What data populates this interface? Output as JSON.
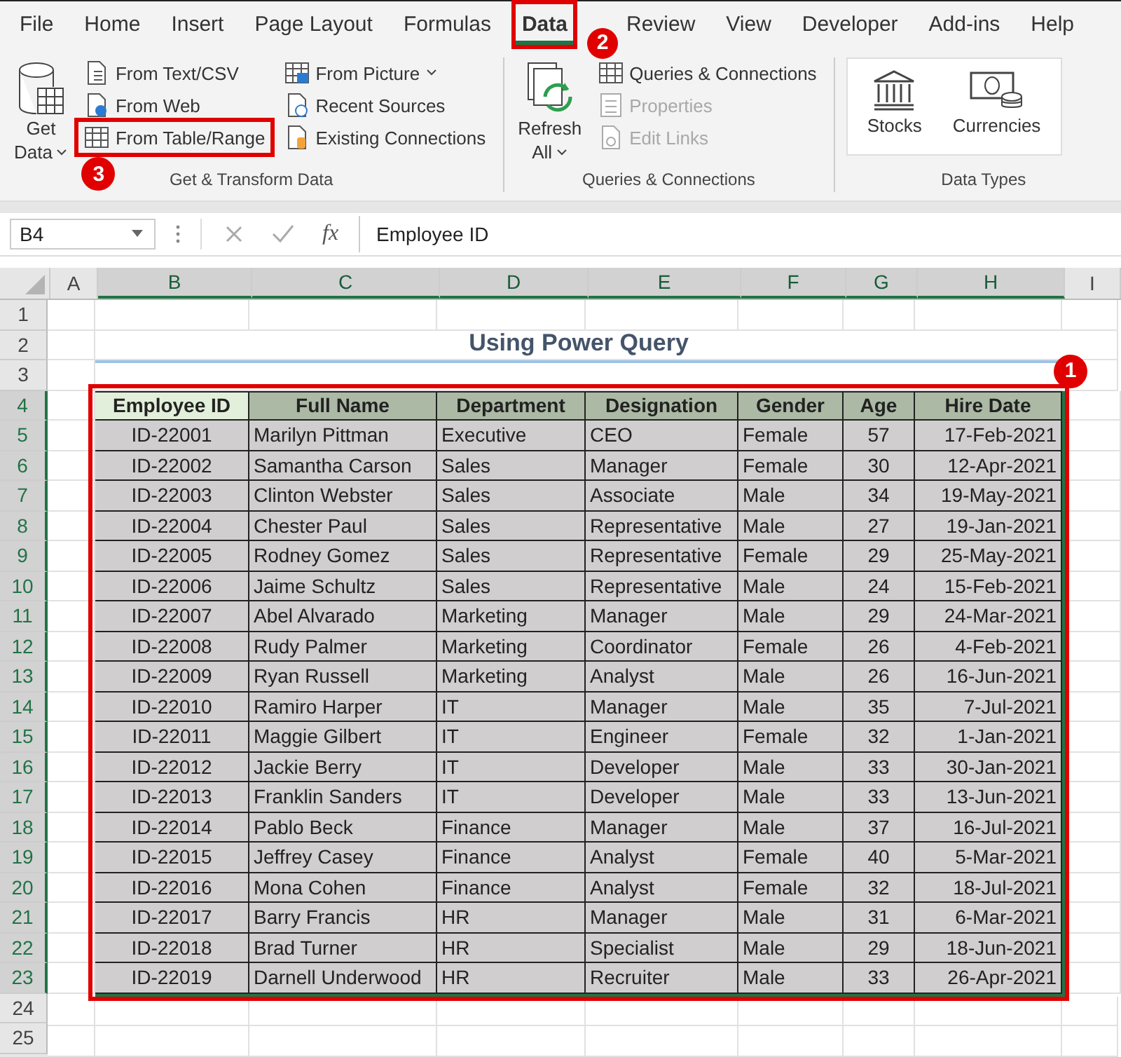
{
  "ribbon_tabs": [
    {
      "label": "File",
      "selected": false
    },
    {
      "label": "Home",
      "selected": false
    },
    {
      "label": "Insert",
      "selected": false
    },
    {
      "label": "Page Layout",
      "selected": false
    },
    {
      "label": "Formulas",
      "selected": false
    },
    {
      "label": "Data",
      "selected": true,
      "callout": "2"
    },
    {
      "label": "Review",
      "selected": false
    },
    {
      "label": "View",
      "selected": false
    },
    {
      "label": "Developer",
      "selected": false
    },
    {
      "label": "Add-ins",
      "selected": false
    },
    {
      "label": "Help",
      "selected": false
    }
  ],
  "ribbon_groups": [
    {
      "label": "Get & Transform Data",
      "big": {
        "kind": "database",
        "lines": [
          "Get",
          "Data"
        ],
        "dropdown": true
      },
      "columns": [
        [
          {
            "kind": "text-file",
            "label": "From Text/CSV",
            "disabled": false
          },
          {
            "kind": "web",
            "label": "From Web",
            "disabled": false
          },
          {
            "kind": "table",
            "label": "From Table/Range",
            "disabled": false,
            "callout": "3"
          }
        ],
        [
          {
            "kind": "picture",
            "label": "From Picture",
            "disabled": false,
            "dropdown": true
          },
          {
            "kind": "recent",
            "label": "Recent Sources",
            "disabled": false
          },
          {
            "kind": "connection",
            "label": "Existing Connections",
            "disabled": false
          }
        ]
      ]
    },
    {
      "label": "Queries & Connections",
      "big": {
        "kind": "refresh",
        "lines": [
          "Refresh",
          "All"
        ],
        "dropdown": true
      },
      "columns": [
        [
          {
            "kind": "queries",
            "label": "Queries & Connections",
            "disabled": false
          },
          {
            "kind": "properties",
            "label": "Properties",
            "disabled": true
          },
          {
            "kind": "links",
            "label": "Edit Links",
            "disabled": true
          }
        ]
      ]
    },
    {
      "label": "Data Types",
      "gallery": [
        {
          "kind": "bank",
          "label": "Stocks"
        },
        {
          "kind": "currency",
          "label": "Currencies"
        }
      ]
    }
  ],
  "formula_bar": {
    "name_box": "B4",
    "fx": "fx",
    "formula": "Employee ID"
  },
  "column_headers": [
    {
      "label": "A",
      "selected": false
    },
    {
      "label": "B",
      "selected": true
    },
    {
      "label": "C",
      "selected": true
    },
    {
      "label": "D",
      "selected": true
    },
    {
      "label": "E",
      "selected": true
    },
    {
      "label": "F",
      "selected": true
    },
    {
      "label": "G",
      "selected": true
    },
    {
      "label": "H",
      "selected": true
    },
    {
      "label": "I",
      "selected": false
    }
  ],
  "row_headers": [
    {
      "label": "1",
      "selected": false
    },
    {
      "label": "2",
      "selected": false
    },
    {
      "label": "3",
      "selected": false
    },
    {
      "label": "4",
      "selected": true
    },
    {
      "label": "5",
      "selected": true
    },
    {
      "label": "6",
      "selected": true
    },
    {
      "label": "7",
      "selected": true
    },
    {
      "label": "8",
      "selected": true
    },
    {
      "label": "9",
      "selected": true
    },
    {
      "label": "10",
      "selected": true
    },
    {
      "label": "11",
      "selected": true
    },
    {
      "label": "12",
      "selected": true
    },
    {
      "label": "13",
      "selected": true
    },
    {
      "label": "14",
      "selected": true
    },
    {
      "label": "15",
      "selected": true
    },
    {
      "label": "16",
      "selected": true
    },
    {
      "label": "17",
      "selected": true
    },
    {
      "label": "18",
      "selected": true
    },
    {
      "label": "19",
      "selected": true
    },
    {
      "label": "20",
      "selected": true
    },
    {
      "label": "21",
      "selected": true
    },
    {
      "label": "22",
      "selected": true
    },
    {
      "label": "23",
      "selected": true
    },
    {
      "label": "24",
      "selected": false
    },
    {
      "label": "25",
      "selected": false
    }
  ],
  "sheet_title": "Using Power Query",
  "table": {
    "callout": "1",
    "columns": [
      "Employee ID",
      "Full Name",
      "Department",
      "Designation",
      "Gender",
      "Age",
      "Hire Date"
    ],
    "rows": [
      [
        "ID-22001",
        "Marilyn Pittman",
        "Executive",
        "CEO",
        "Female",
        "57",
        "17-Feb-2021"
      ],
      [
        "ID-22002",
        "Samantha Carson",
        "Sales",
        "Manager",
        "Female",
        "30",
        "12-Apr-2021"
      ],
      [
        "ID-22003",
        "Clinton Webster",
        "Sales",
        "Associate",
        "Male",
        "34",
        "19-May-2021"
      ],
      [
        "ID-22004",
        "Chester Paul",
        "Sales",
        "Representative",
        "Male",
        "27",
        "19-Jan-2021"
      ],
      [
        "ID-22005",
        "Rodney Gomez",
        "Sales",
        "Representative",
        "Female",
        "29",
        "25-May-2021"
      ],
      [
        "ID-22006",
        "Jaime Schultz",
        "Sales",
        "Representative",
        "Male",
        "24",
        "15-Feb-2021"
      ],
      [
        "ID-22007",
        "Abel Alvarado",
        "Marketing",
        "Manager",
        "Male",
        "29",
        "24-Mar-2021"
      ],
      [
        "ID-22008",
        "Rudy Palmer",
        "Marketing",
        "Coordinator",
        "Female",
        "26",
        "4-Feb-2021"
      ],
      [
        "ID-22009",
        "Ryan Russell",
        "Marketing",
        "Analyst",
        "Male",
        "26",
        "16-Jun-2021"
      ],
      [
        "ID-22010",
        "Ramiro Harper",
        "IT",
        "Manager",
        "Male",
        "35",
        "7-Jul-2021"
      ],
      [
        "ID-22011",
        "Maggie Gilbert",
        "IT",
        "Engineer",
        "Female",
        "32",
        "1-Jan-2021"
      ],
      [
        "ID-22012",
        "Jackie Berry",
        "IT",
        "Developer",
        "Male",
        "33",
        "30-Jan-2021"
      ],
      [
        "ID-22013",
        "Franklin Sanders",
        "IT",
        "Developer",
        "Male",
        "33",
        "13-Jun-2021"
      ],
      [
        "ID-22014",
        "Pablo Beck",
        "Finance",
        "Manager",
        "Male",
        "37",
        "16-Jul-2021"
      ],
      [
        "ID-22015",
        "Jeffrey Casey",
        "Finance",
        "Analyst",
        "Female",
        "40",
        "5-Mar-2021"
      ],
      [
        "ID-22016",
        "Mona Cohen",
        "Finance",
        "Analyst",
        "Female",
        "32",
        "18-Jul-2021"
      ],
      [
        "ID-22017",
        "Barry Francis",
        "HR",
        "Manager",
        "Male",
        "31",
        "6-Mar-2021"
      ],
      [
        "ID-22018",
        "Brad Turner",
        "HR",
        "Specialist",
        "Male",
        "29",
        "18-Jun-2021"
      ],
      [
        "ID-22019",
        "Darnell Underwood",
        "HR",
        "Recruiter",
        "Male",
        "33",
        "26-Apr-2021"
      ]
    ]
  }
}
